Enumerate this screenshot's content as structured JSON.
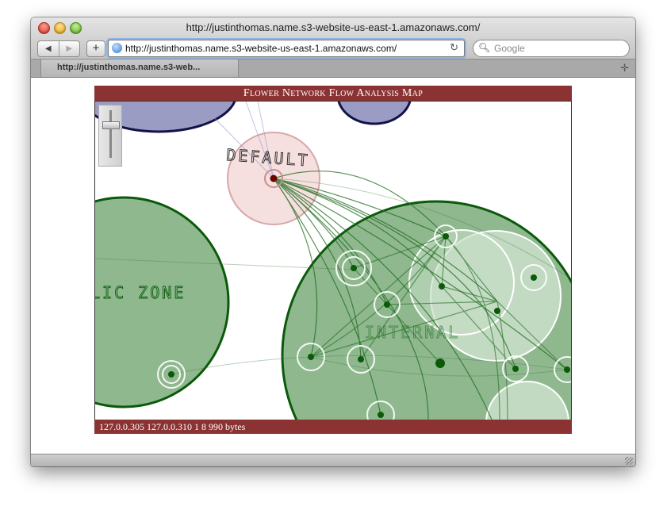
{
  "window": {
    "title": "http://justinthomas.name.s3-website-us-east-1.amazonaws.com/"
  },
  "toolbar": {
    "back_label": "◀",
    "forward_label": "▶",
    "add_label": "+",
    "url": "http://justinthomas.name.s3-website-us-east-1.amazonaws.com/",
    "reload_label": "↻",
    "search_placeholder": "Google"
  },
  "tab": {
    "label": "http://justinthomas.name.s3-web..."
  },
  "applet": {
    "title": "Flower Network Flow Analysis Map",
    "status": "127.0.0.305  127.0.0.310  1  8  990 bytes",
    "zones": [
      {
        "label": "DEFAULT"
      },
      {
        "label": "LIC ZONE"
      },
      {
        "label": "INTERNAL"
      }
    ]
  },
  "colors": {
    "accent": "#8b3232",
    "zone_green": "#8fb88f",
    "zone_border": "#0a5a0a",
    "zone_blue": "#9a9cc4",
    "default_pink": "#f2d7d7"
  }
}
